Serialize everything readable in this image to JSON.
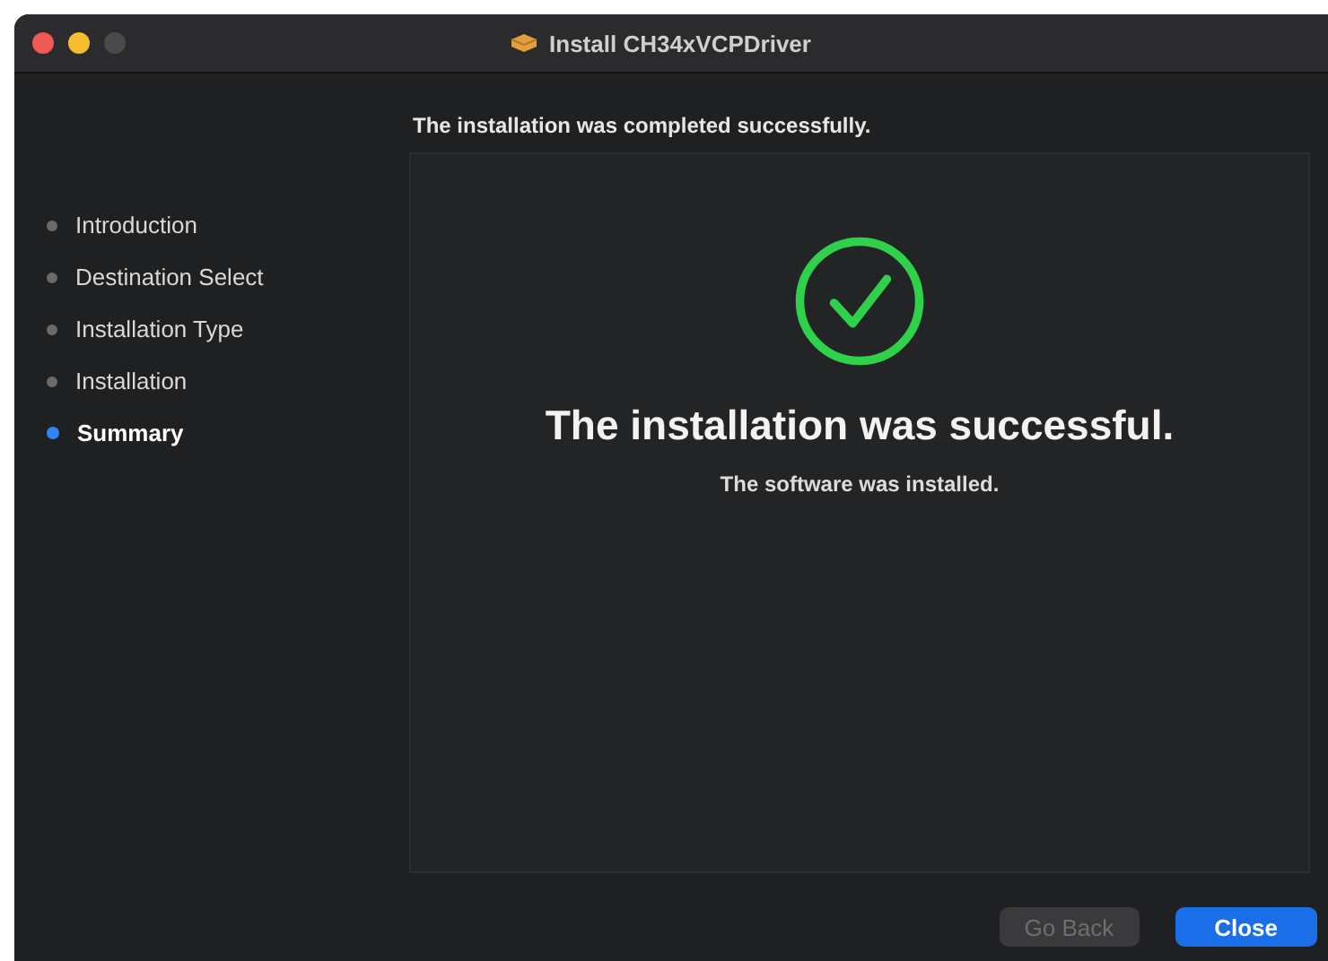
{
  "window": {
    "title": "Install CH34xVCPDriver"
  },
  "header": "The installation was completed successfully.",
  "steps": [
    {
      "label": "Introduction",
      "selected": false
    },
    {
      "label": "Destination Select",
      "selected": false
    },
    {
      "label": "Installation Type",
      "selected": false
    },
    {
      "label": "Installation",
      "selected": false
    },
    {
      "label": "Summary",
      "selected": true
    }
  ],
  "result": {
    "headline": "The installation was successful.",
    "detail": "The software was installed."
  },
  "buttons": [
    {
      "label": "Go Back",
      "disabled": true,
      "default": false
    },
    {
      "label": "Close",
      "disabled": false,
      "default": true
    }
  ]
}
